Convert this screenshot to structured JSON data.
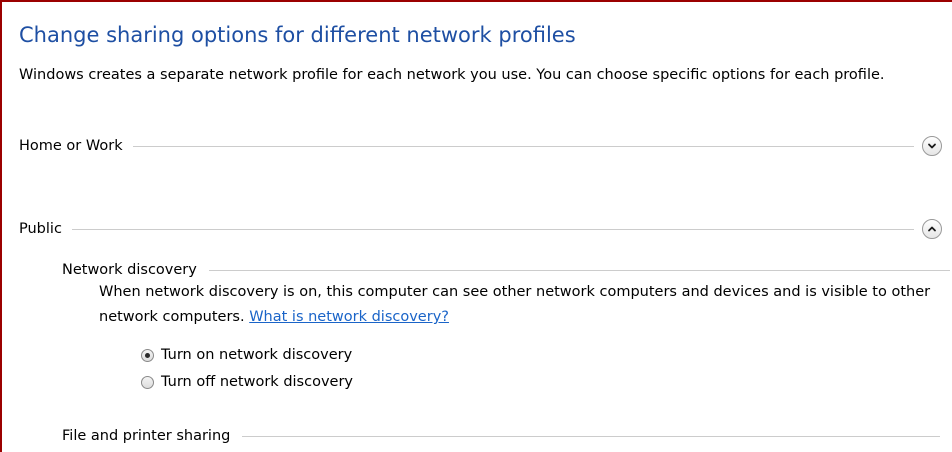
{
  "page": {
    "title": "Change sharing options for different network profiles",
    "intro": "Windows creates a separate network profile for each network you use. You can choose specific options for each profile."
  },
  "profiles": [
    {
      "label": "Home or Work",
      "expanded": false,
      "toggle_icon": "chevron-down-icon"
    },
    {
      "label": "Public",
      "expanded": true,
      "toggle_icon": "chevron-up-icon"
    }
  ],
  "network_discovery": {
    "heading": "Network discovery",
    "description": "When network discovery is on, this computer can see other network computers and devices and is visible to other network computers.",
    "link_text": "What is network discovery?",
    "options": [
      {
        "label": "Turn on network discovery",
        "selected": true
      },
      {
        "label": "Turn off network discovery",
        "selected": false
      }
    ]
  },
  "file_printer_sharing": {
    "heading": "File and printer sharing"
  },
  "colors": {
    "title": "#1e4fa3",
    "link": "#1a64c8",
    "frame_border": "#9b0000"
  }
}
